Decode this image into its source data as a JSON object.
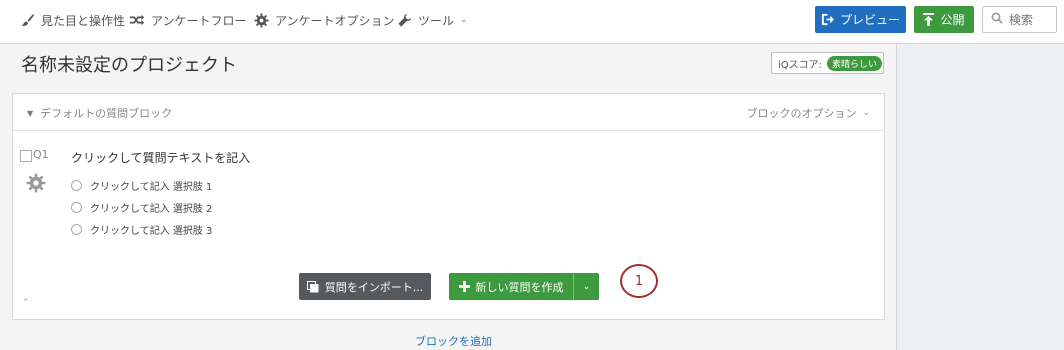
{
  "nav": {
    "items": [
      {
        "label": "見た目と操作性",
        "icon": "paintbrush-icon"
      },
      {
        "label": "アンケートフロー",
        "icon": "flow-icon"
      },
      {
        "label": "アンケートオプション",
        "icon": "gear-icon"
      },
      {
        "label": "ツール",
        "icon": "wrench-icon"
      }
    ],
    "preview_label": "プレビュー",
    "publish_label": "公開",
    "search_placeholder": "検索"
  },
  "project": {
    "title": "名称未設定のプロジェクト",
    "iq_label": "iQスコア:",
    "iq_value": "素晴らしい"
  },
  "block": {
    "title": "デフォルトの質問ブロック",
    "options_label": "ブロックのオプション",
    "question": {
      "number": "Q1",
      "text": "クリックして質問テキストを記入",
      "choices": [
        "クリックして記入 選択肢 1",
        "クリックして記入 選択肢 2",
        "クリックして記入 選択肢 3"
      ]
    },
    "import_label": "質問をインポート...",
    "new_question_label": "新しい質問を作成"
  },
  "annotation": {
    "step": "1"
  },
  "add_block_label": "ブロックを追加",
  "colors": {
    "primary": "#1f6ebf",
    "success": "#3e9a3e",
    "annotation": "#a33030"
  }
}
